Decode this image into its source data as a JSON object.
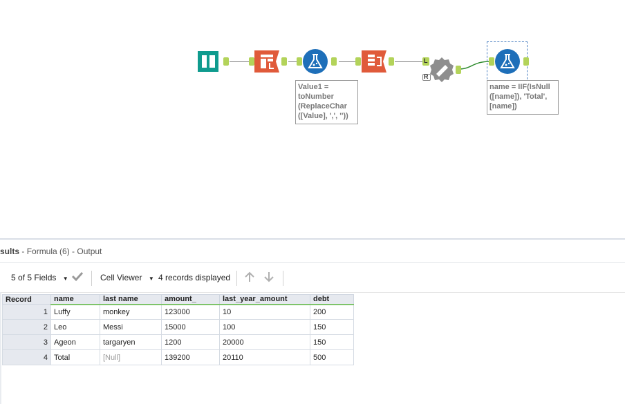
{
  "workflow": {
    "tools": [
      {
        "id": "input",
        "icon": "input-data-icon",
        "color": "#0f9b8e"
      },
      {
        "id": "text-to-columns",
        "icon": "text-to-columns-icon",
        "color": "#e05a3a"
      },
      {
        "id": "formula-1",
        "icon": "formula-flask-icon",
        "color": "#1e6fb9"
      },
      {
        "id": "transpose",
        "icon": "transpose-icon",
        "color": "#e05a3a"
      },
      {
        "id": "summarize",
        "icon": "summarize-icon",
        "color": "#8a8a8a"
      },
      {
        "id": "formula-6",
        "icon": "formula-flask-icon",
        "color": "#1e6fb9"
      }
    ],
    "annotation_1": [
      "Value1 =",
      "toNumber",
      "(ReplaceChar",
      "([Value], ',', ''))"
    ],
    "annotation_2": [
      "name = IIF(IsNull",
      "([name]), 'Total',",
      "[name])"
    ],
    "anchor_labels": {
      "l": "L",
      "r": "R"
    }
  },
  "results": {
    "title_bold": "sults",
    "title_rest": "- Formula (6) - Output"
  },
  "toolbar": {
    "fields_label": "5 of 5 Fields",
    "viewer_label": "Cell Viewer",
    "records_label": "4 records displayed"
  },
  "table": {
    "columns": [
      "Record",
      "name",
      "last name",
      "amount_",
      "last_year_amount",
      "debt"
    ],
    "rows": [
      [
        "1",
        "Luffy",
        "monkey",
        "123000",
        "10",
        "200"
      ],
      [
        "2",
        "Leo",
        "Messi",
        "15000",
        "100",
        "150"
      ],
      [
        "3",
        "Ageon",
        "targaryen",
        "1200",
        "20000",
        "150"
      ],
      [
        "4",
        "Total",
        "[Null]",
        "139200",
        "20110",
        "500"
      ]
    ]
  }
}
